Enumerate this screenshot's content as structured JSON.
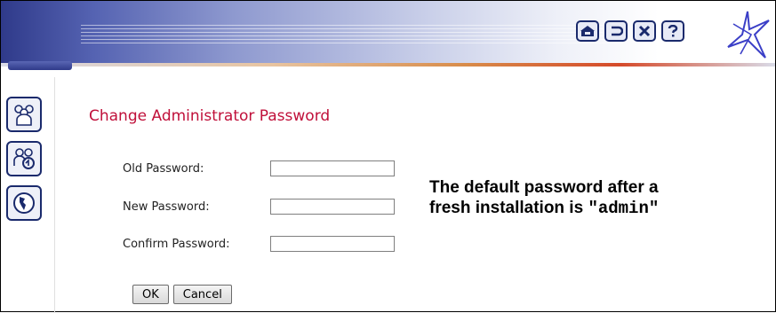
{
  "toolbar": {
    "icons": [
      "home-icon",
      "back-icon",
      "close-icon",
      "help-icon"
    ],
    "logo": "star-logo"
  },
  "nav": {
    "items": [
      "users-icon",
      "user-group-refresh-icon",
      "globe-icon"
    ]
  },
  "page": {
    "title": "Change Administrator Password"
  },
  "form": {
    "old_password": {
      "label": "Old Password:",
      "value": ""
    },
    "new_password": {
      "label": "New Password:",
      "value": ""
    },
    "confirm_password": {
      "label": "Confirm Password:",
      "value": ""
    }
  },
  "note": {
    "line1": "The default password after a",
    "line2_prefix": "fresh installation is ",
    "line2_value": "\"admin\""
  },
  "buttons": {
    "ok": "OK",
    "cancel": "Cancel"
  },
  "colors": {
    "title": "#c0103a",
    "banner_dark": "#2f3a8a",
    "icon_border": "#1a2a6c"
  }
}
